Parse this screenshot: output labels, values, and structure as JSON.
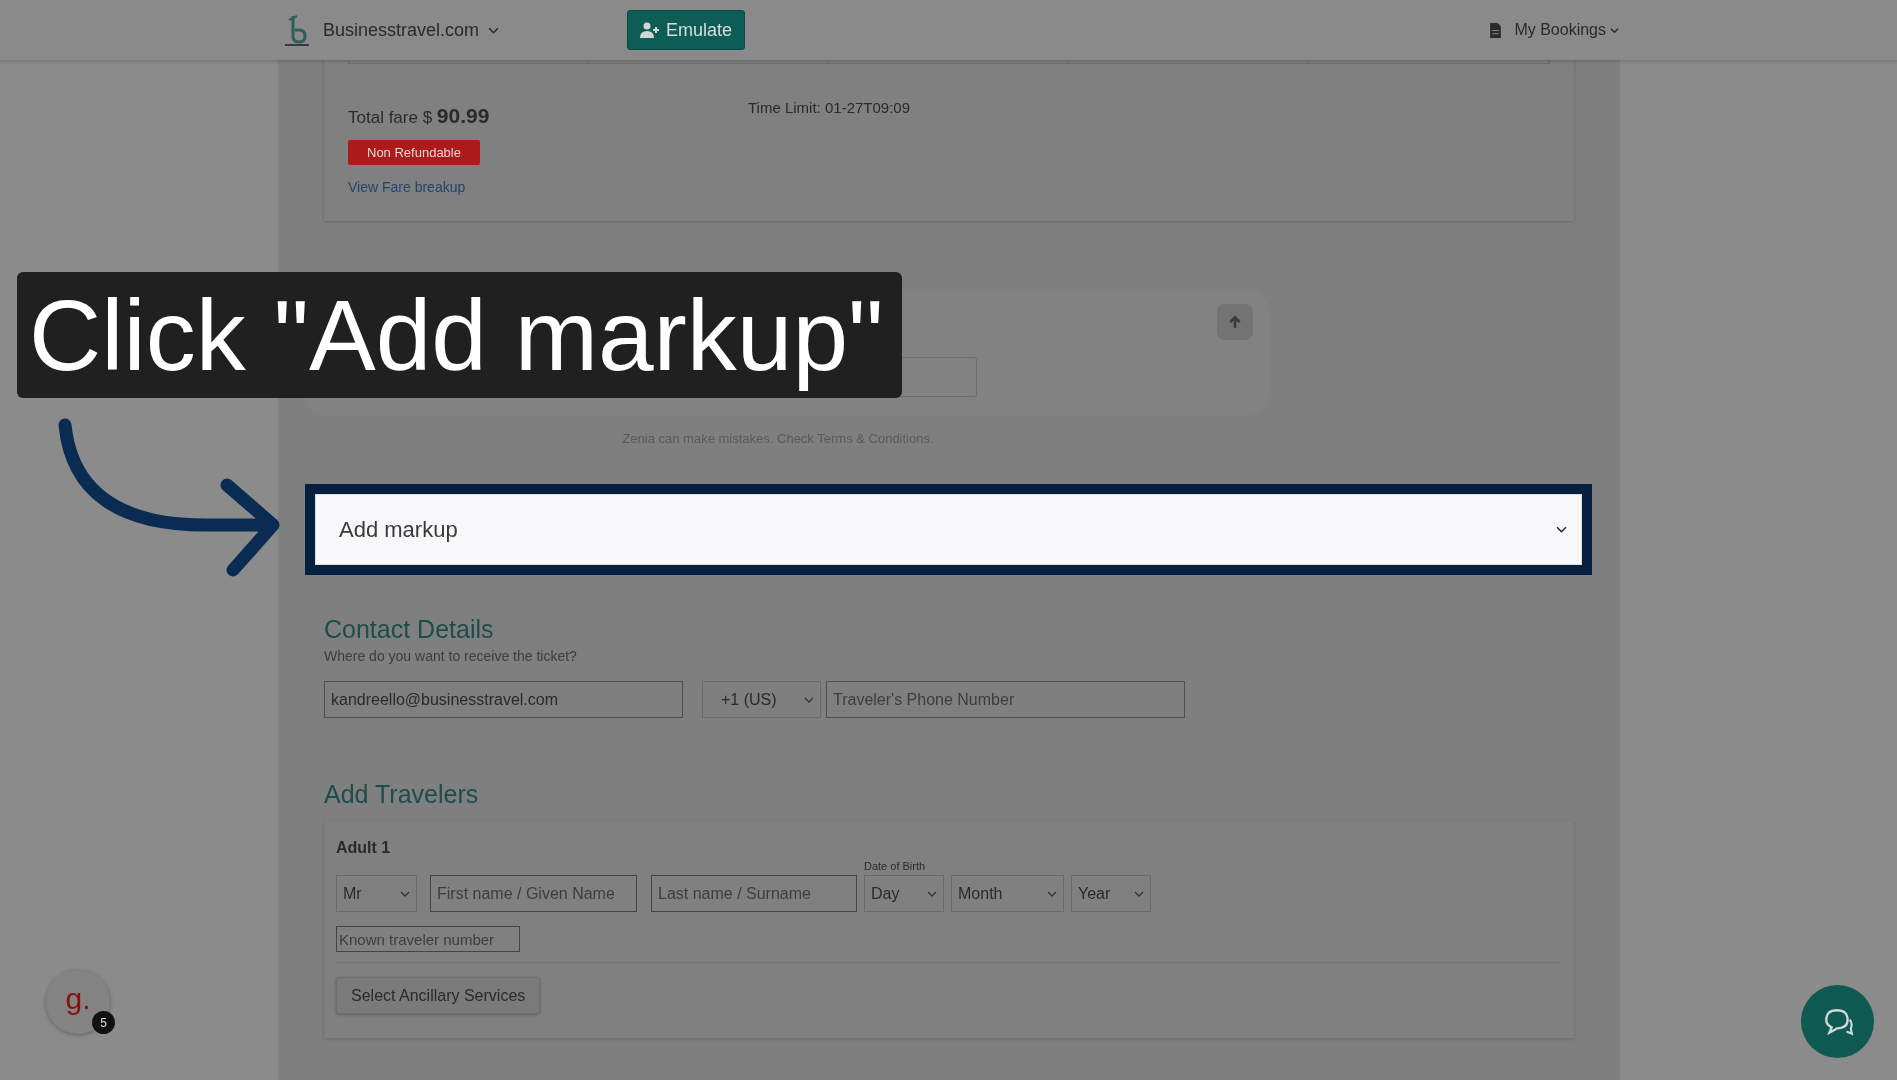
{
  "navbar": {
    "brand": "Businesstravel.com",
    "emulate_button": "Emulate",
    "bookings_menu": "My Bookings"
  },
  "fare": {
    "total_label": "Total fare $",
    "total_amount": "90.99",
    "time_limit": "Time Limit: 01-27T09:09",
    "refund_badge": "Non Refundable",
    "breakup_link": "View Fare breakup"
  },
  "chat": {
    "disclaimer": "Zenia can make mistakes. Check Terms & Conditions."
  },
  "tutorial": {
    "caption": "Click \"Add markup\""
  },
  "markup": {
    "label": "Add markup"
  },
  "contact": {
    "title": "Contact Details",
    "subtitle": "Where do you want to receive the ticket?",
    "email": "kandreello@businesstravel.com",
    "country_code": "+1 (US)",
    "phone_placeholder": "Traveler's Phone Number"
  },
  "travelers": {
    "title": "Add Travelers",
    "adults": [
      {
        "label": "Adult 1",
        "title": "Mr",
        "first_name_placeholder": "First name / Given Name",
        "last_name_placeholder": "Last name / Surname",
        "dob_label": "Date of Birth",
        "day": "Day",
        "month": "Month",
        "year": "Year",
        "ktn_placeholder": "Known traveler number",
        "ancillary_button": "Select Ancillary Services"
      }
    ]
  },
  "assistant": {
    "avatar_letter": "g.",
    "badge": "5"
  }
}
